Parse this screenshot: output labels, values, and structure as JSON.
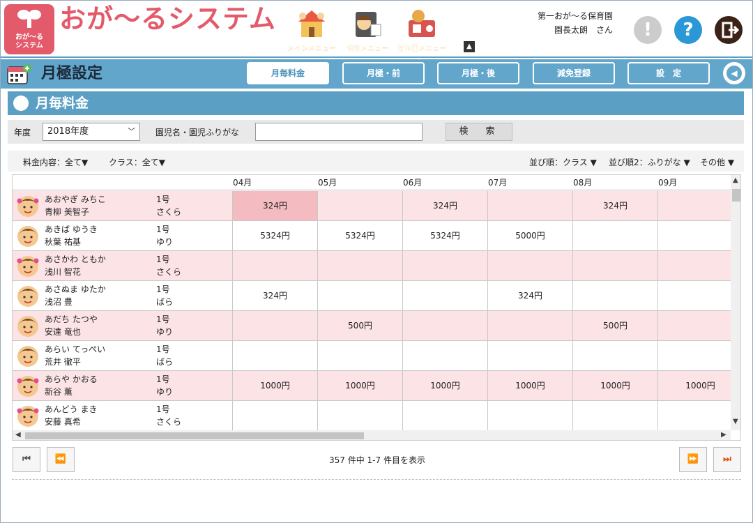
{
  "header": {
    "logo_text_line1": "おが～る",
    "logo_text_line2": "システム",
    "brand": "おが～るシステム",
    "menus": [
      {
        "label": "メインメニュー",
        "icon": "house-icon"
      },
      {
        "label": "保育メニュー",
        "icon": "childcare-icon"
      },
      {
        "label": "登降園メニュー",
        "icon": "attendance-icon"
      }
    ],
    "facility": "第一おが～る保育園",
    "user": "園長太朗　さん",
    "notice_icon": "!",
    "help_icon": "?",
    "colors": {
      "brand": "#e35a6a",
      "accent": "#5ba0c4"
    }
  },
  "titlebar": {
    "title": "月極設定",
    "tabs": [
      "月毎料金",
      "月極・前",
      "月極・後",
      "減免登録",
      "設　定"
    ],
    "active_tab": 0
  },
  "section": {
    "title": "月毎料金"
  },
  "search": {
    "year_label": "年度",
    "year_value": "2018年度",
    "name_label": "園児名・園児ふりがな",
    "name_value": "",
    "search_button": "検　索"
  },
  "filters": {
    "fee_content": "料金内容：全て▼",
    "class": "クラス：全て▼",
    "sort1": "並び順：クラス ▼",
    "sort2": "並び順2：ふりがな ▼",
    "other": "その他 ▼"
  },
  "months": [
    "04月",
    "05月",
    "06月",
    "07月",
    "08月",
    "09月"
  ],
  "rows": [
    {
      "kana": "あおやぎ みちこ",
      "name": "青柳 美智子",
      "class_no": "1号",
      "class": "さくら",
      "girl": true,
      "fees": [
        "324円",
        "",
        "324円",
        "",
        "324円",
        ""
      ]
    },
    {
      "kana": "あきば ゆうき",
      "name": "秋葉 祐基",
      "class_no": "1号",
      "class": "ゆり",
      "girl": false,
      "fees": [
        "5324円",
        "5324円",
        "5324円",
        "5000円",
        "",
        ""
      ]
    },
    {
      "kana": "あさかわ ともか",
      "name": "浅川 智花",
      "class_no": "1号",
      "class": "さくら",
      "girl": true,
      "fees": [
        "",
        "",
        "",
        "",
        "",
        ""
      ]
    },
    {
      "kana": "あさぬま ゆたか",
      "name": "浅沼 豊",
      "class_no": "1号",
      "class": "ばら",
      "girl": false,
      "fees": [
        "324円",
        "",
        "",
        "324円",
        "",
        ""
      ]
    },
    {
      "kana": "あだち たつや",
      "name": "安達 竜也",
      "class_no": "1号",
      "class": "ゆり",
      "girl": false,
      "fees": [
        "",
        "500円",
        "",
        "",
        "500円",
        ""
      ]
    },
    {
      "kana": "あらい てっぺい",
      "name": "荒井 徹平",
      "class_no": "1号",
      "class": "ばら",
      "girl": false,
      "fees": [
        "",
        "",
        "",
        "",
        "",
        ""
      ]
    },
    {
      "kana": "あらや かおる",
      "name": "新谷 薫",
      "class_no": "1号",
      "class": "ゆり",
      "girl": true,
      "fees": [
        "1000円",
        "1000円",
        "1000円",
        "1000円",
        "1000円",
        "1000円"
      ]
    },
    {
      "kana": "あんどう まき",
      "name": "安藤 真希",
      "class_no": "1号",
      "class": "さくら",
      "girl": true,
      "fees": [
        "",
        "",
        "",
        "",
        "",
        ""
      ]
    }
  ],
  "pager": {
    "first": "⏮",
    "prev": "⏪",
    "next": "⏩",
    "last": "⏭",
    "info": "357 件中 1-7 件目を表示"
  }
}
